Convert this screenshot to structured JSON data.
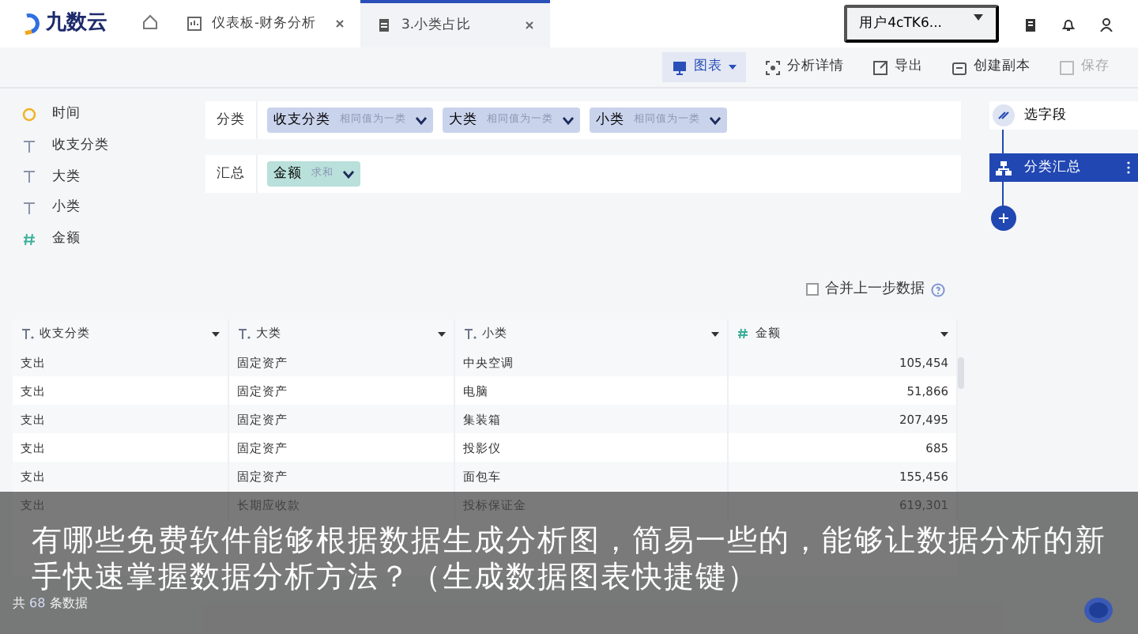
{
  "app": {
    "logo": "九数云"
  },
  "tabs": [
    {
      "label": "仪表板-财务分析",
      "selected": false,
      "kind": "dashboard"
    },
    {
      "label": "3.小类占比",
      "selected": true,
      "kind": "sheet"
    }
  ],
  "user": {
    "name": "用户4cTK6..."
  },
  "toolbar": [
    {
      "label": "图表",
      "kind": "chart",
      "disabled": false,
      "dropdown": true
    },
    {
      "label": "分析详情",
      "kind": "detail",
      "disabled": false,
      "dropdown": false
    },
    {
      "label": "导出",
      "kind": "export",
      "disabled": false,
      "dropdown": false
    },
    {
      "label": "创建副本",
      "kind": "copy",
      "disabled": false,
      "dropdown": false
    },
    {
      "label": "保存",
      "kind": "save",
      "disabled": true,
      "dropdown": false
    }
  ],
  "fields": [
    {
      "name": "时间",
      "kind": "time"
    },
    {
      "name": "收支分类",
      "kind": "text"
    },
    {
      "name": "大类",
      "kind": "text"
    },
    {
      "name": "小类",
      "kind": "text"
    },
    {
      "name": "金额",
      "kind": "number"
    }
  ],
  "config": [
    {
      "label": "分类",
      "kind": "group",
      "chips": [
        {
          "name": "收支分类",
          "hint": "相同值为一类"
        },
        {
          "name": "大类",
          "hint": "相同值为一类"
        },
        {
          "name": "小类",
          "hint": "相同值为一类"
        }
      ]
    },
    {
      "label": "汇总",
      "kind": "sum",
      "chips": [
        {
          "name": "金额",
          "hint": "求和"
        }
      ]
    }
  ],
  "merge": {
    "label": "合并上一步数据",
    "checked": false
  },
  "steps": [
    {
      "label": "选字段",
      "selected": false
    },
    {
      "label": "分类汇总",
      "selected": true
    }
  ],
  "table": {
    "columns": [
      {
        "name": "收支分类",
        "kind": "text"
      },
      {
        "name": "大类",
        "kind": "text"
      },
      {
        "name": "小类",
        "kind": "text"
      },
      {
        "name": "金额",
        "kind": "number"
      }
    ],
    "rows": [
      [
        "支出",
        "固定资产",
        "中央空调",
        "105,454"
      ],
      [
        "支出",
        "固定资产",
        "电脑",
        "51,866"
      ],
      [
        "支出",
        "固定资产",
        "集装箱",
        "207,495"
      ],
      [
        "支出",
        "固定资产",
        "投影仪",
        "685"
      ],
      [
        "支出",
        "固定资产",
        "面包车",
        "155,456"
      ],
      [
        "支出",
        "长期应收款",
        "投标保证金",
        "619,301"
      ]
    ],
    "footer": {
      "prefix": "共",
      "count": "68",
      "suffix": "条数据"
    }
  },
  "caption": "有哪些免费软件能够根据数据生成分析图，简易一些的，能够让数据分析的新手快速掌握数据分析方法？（生成数据图表快捷键）"
}
